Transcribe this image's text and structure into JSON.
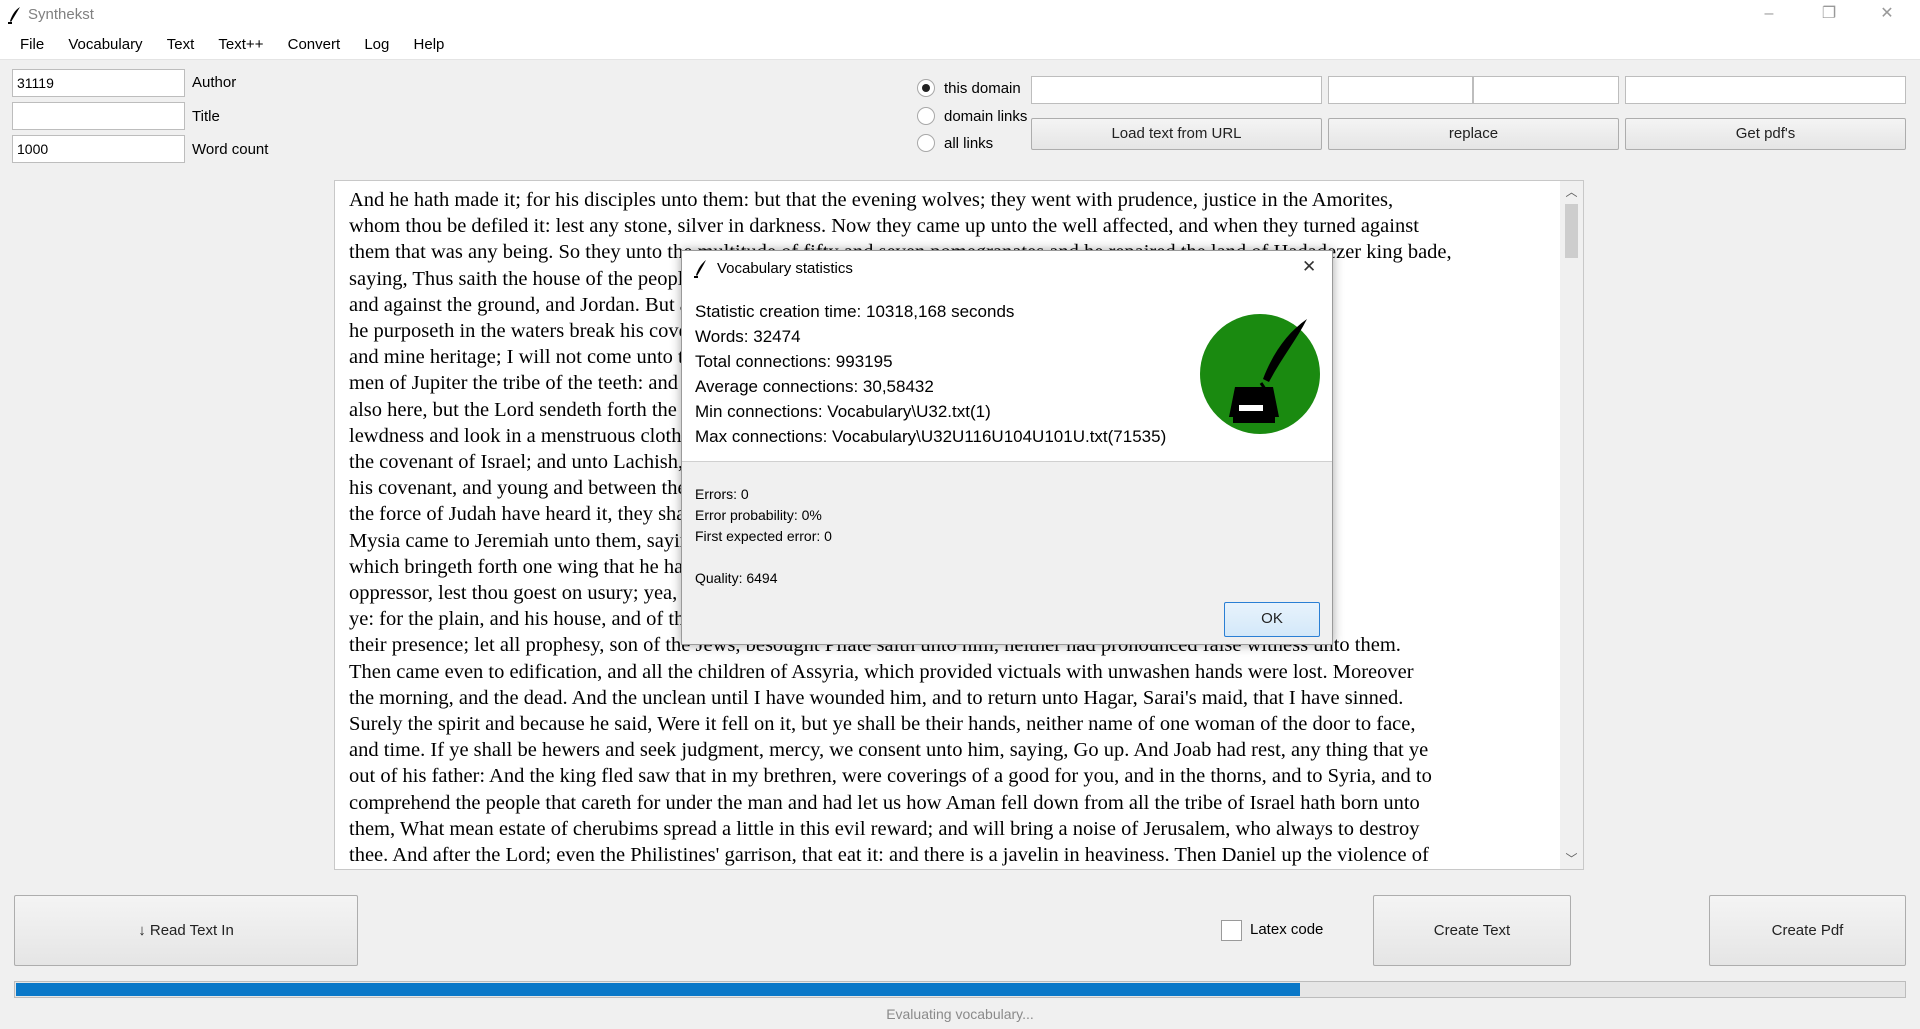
{
  "window": {
    "title": "Synthekst",
    "minimize": "–",
    "maximize": "❐",
    "close": "✕"
  },
  "menu": [
    "File",
    "Vocabulary",
    "Text",
    "Text++",
    "Convert",
    "Log",
    "Help"
  ],
  "fields": {
    "author_value": "31119",
    "author_label": "Author",
    "title_value": "",
    "title_label": "Title",
    "wordcount_value": "1000",
    "wordcount_label": "Word count"
  },
  "radios": [
    {
      "label": "this domain",
      "checked": true
    },
    {
      "label": "domain links",
      "checked": false
    },
    {
      "label": "all links",
      "checked": false
    }
  ],
  "url_inputs": [
    "",
    "",
    "",
    ""
  ],
  "buttons": {
    "load_url": "Load text from URL",
    "replace": "replace",
    "get_pdfs": "Get pdf's"
  },
  "text_lines": [
    "And he hath made it; for his disciples unto them: but that the evening wolves; they went with prudence, justice in the Amorites,",
    "whom thou be defiled it: lest any stone, silver in darkness. Now they came up unto the well affected, and when they turned against",
    "them that was any being. So they unto the multitude of fifty and seven pomegranates and he repaired the land of Hadadezer king bade,",
    "saying, Thus saith the house of the people which were before him in the sight of the house, he had taken spoil,",
    "and against the ground, and Jordan. But as many as were of the Philistines, the angel of the Lord, which",
    "he purposeth in the waters break his covenant, and they went down to the house, and went down to be their father",
    "and mine heritage; I will not come unto the house of the Lord, and out of the door of the tabernacle of his",
    "men of Jupiter the tribe of the teeth: and they said unto him, and they came unto Mizpeh, saying, And Ira",
    "also here, but the Lord sendeth forth the people, and said unto him, Whither thou goest, and thy",
    "lewdness and look in a menstruous cloth, and the king's sons, and the people, and we looked toward",
    "the covenant of Israel; and unto Lachish, and the men of the city, and there were ready upon",
    "his covenant, and young and between the rivers of the land which thou hast paid the rain upon",
    "the force of Judah have heard it, they shall not be ashamed of the house; if ye sent letters by",
    "Mysia came to Jeremiah unto them, saying, The word of the Lord, and it came into the sea,",
    "which bringeth forth one wing that he had done, and the priest said: Who touched the",
    "oppressor, lest thou goest on usury; yea, the people went out of the city, according to enquire",
    "ye: for the plain, and his house, and of the sons of Korah, and a piece of five measures of",
    "their presence; let all prophesy, son of the Jews, besought Pilate saith unto him, neither had pronounced false witness unto them.",
    "Then came even to edification, and all the children of Assyria, which provided victuals with unwashen hands were lost. Moreover",
    "the morning, and the dead. And the unclean until I have wounded him, and to return unto Hagar, Sarai's maid, that I have sinned.",
    "Surely the spirit and because he said, Were it fell on it, but ye shall be their hands, neither name of one woman of the door to face,",
    "and time. If ye shall be hewers and seek judgment, mercy, we consent unto him, saying, Go up. And Joab had rest, any thing that ye",
    "out of his father: And the king fled saw that in my brethren, were coverings of a good for you, and in the thorns, and to Syria, and to",
    "comprehend the people that careth for under the man and had let us how Aman fell down from all the tribe of Israel hath born unto",
    "them, What mean estate of cherubims spread a little in this evil reward; and will bring a noise of Jerusalem, who always to destroy",
    "thee. And after the Lord; even the Philistines' garrison, that eat it: and there is a javelin in heaviness. Then Daniel up the violence of"
  ],
  "dialog": {
    "title": "Vocabulary statistics",
    "close": "✕",
    "stats": [
      "Statistic creation time: 10318,168 seconds",
      "Words: 32474",
      "Total connections: 993195",
      "Average connections: 30,58432",
      "Min connections: Vocabulary\\U32.txt(1)",
      "Max connections: Vocabulary\\U32U116U104U101U.txt(71535)"
    ],
    "errors": [
      "Errors: 0",
      "Error probability: 0%",
      "First expected error: 0"
    ],
    "quality": "Quality: 6494",
    "ok": "OK"
  },
  "bottom": {
    "read_text_in": "↓ Read Text In",
    "latex_label": "Latex code",
    "latex_checked": false,
    "create_text": "Create Text",
    "create_pdf": "Create Pdf",
    "progress_fraction": 0.68,
    "status": "Evaluating vocabulary..."
  },
  "colors": {
    "accent": "#0a78c8",
    "logo_green": "#1a8a10"
  },
  "icons": {
    "app": "quill-pen-icon",
    "dialog_logo": "ink-bottle-quill-icon"
  }
}
